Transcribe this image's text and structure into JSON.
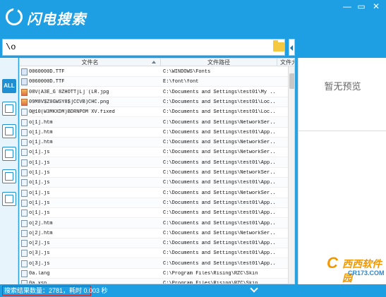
{
  "app": {
    "title": "闪电搜索"
  },
  "search": {
    "value": "\\o"
  },
  "table": {
    "columns": [
      "文件名",
      "文件路径",
      "文件大"
    ],
    "rows": [
      {
        "name": "0060000D.TTF",
        "path": "C:\\WINDOWS\\Fonts",
        "icon": "font-file-icon"
      },
      {
        "name": "0060000D.TTF",
        "path": "E:\\font\\font",
        "icon": "font-file-icon"
      },
      {
        "name": "08V(A3E_G`8ZHOTT]L]`(LR.jpg",
        "path": "C:\\Documents and Settings\\test01\\My ...",
        "icon": "image-file-icon"
      },
      {
        "name": "09M8V$Z0GWSY8$]CCVB)CHC.png",
        "path": "C:\\Documents and Settings\\test01\\Loc...",
        "icon": "image-file-icon"
      },
      {
        "name": "0@10(W3MKXDM)BDRNPOM`XV.fixed",
        "path": "C:\\Documents and Settings\\test01\\Loc...",
        "icon": "file-icon"
      },
      {
        "name": "o[1].htm",
        "path": "C:\\Documents and Settings\\NetworkSer...",
        "icon": "file-icon"
      },
      {
        "name": "o[1].htm",
        "path": "C:\\Documents and Settings\\test01\\App...",
        "icon": "file-icon"
      },
      {
        "name": "o[1].htm",
        "path": "C:\\Documents and Settings\\NetworkSer...",
        "icon": "file-icon"
      },
      {
        "name": "o[1].js",
        "path": "C:\\Documents and Settings\\NetworkSer...",
        "icon": "script-file-icon"
      },
      {
        "name": "o[1].js",
        "path": "C:\\Documents and Settings\\test01\\App...",
        "icon": "script-file-icon"
      },
      {
        "name": "o[1].js",
        "path": "C:\\Documents and Settings\\NetworkSer...",
        "icon": "script-file-icon"
      },
      {
        "name": "o[1].js",
        "path": "C:\\Documents and Settings\\test01\\App...",
        "icon": "script-file-icon"
      },
      {
        "name": "o[1].js",
        "path": "C:\\Documents and Settings\\NetworkSer...",
        "icon": "script-file-icon"
      },
      {
        "name": "o[1].js",
        "path": "C:\\Documents and Settings\\test01\\App...",
        "icon": "script-file-icon"
      },
      {
        "name": "o[1].js",
        "path": "C:\\Documents and Settings\\test01\\App...",
        "icon": "script-file-icon"
      },
      {
        "name": "o[2].htm",
        "path": "C:\\Documents and Settings\\test01\\App...",
        "icon": "file-icon"
      },
      {
        "name": "o[2].htm",
        "path": "C:\\Documents and Settings\\NetworkSer...",
        "icon": "file-icon"
      },
      {
        "name": "o[2].js",
        "path": "C:\\Documents and Settings\\test01\\App...",
        "icon": "script-file-icon"
      },
      {
        "name": "o[3].js",
        "path": "C:\\Documents and Settings\\test01\\App...",
        "icon": "script-file-icon"
      },
      {
        "name": "o[3].js",
        "path": "C:\\Documents and Settings\\test01\\App...",
        "icon": "script-file-icon"
      },
      {
        "name": "0a.lang",
        "path": "C:\\Program Files\\Rising\\RZC\\Skin",
        "icon": "file-icon"
      },
      {
        "name": "0a.xsn",
        "path": "C:\\Program Files\\Rising\\RZC\\Skin",
        "icon": "file-icon"
      }
    ]
  },
  "sidebar": {
    "items": [
      {
        "label": "ALL",
        "icon": "all-icon",
        "active": true
      },
      {
        "label": "",
        "icon": "image-icon"
      },
      {
        "label": "",
        "icon": "document-icon"
      },
      {
        "label": "",
        "icon": "video-icon"
      },
      {
        "label": "",
        "icon": "music-icon"
      },
      {
        "label": "",
        "icon": "mobile-icon"
      }
    ]
  },
  "preview": {
    "text": "暂无预览"
  },
  "status": {
    "text": "搜索结果数量：2781，耗时 0.003 秒"
  },
  "watermark": {
    "logo": "C",
    "brand": "西西软件园",
    "sub": "CR173.COM"
  }
}
